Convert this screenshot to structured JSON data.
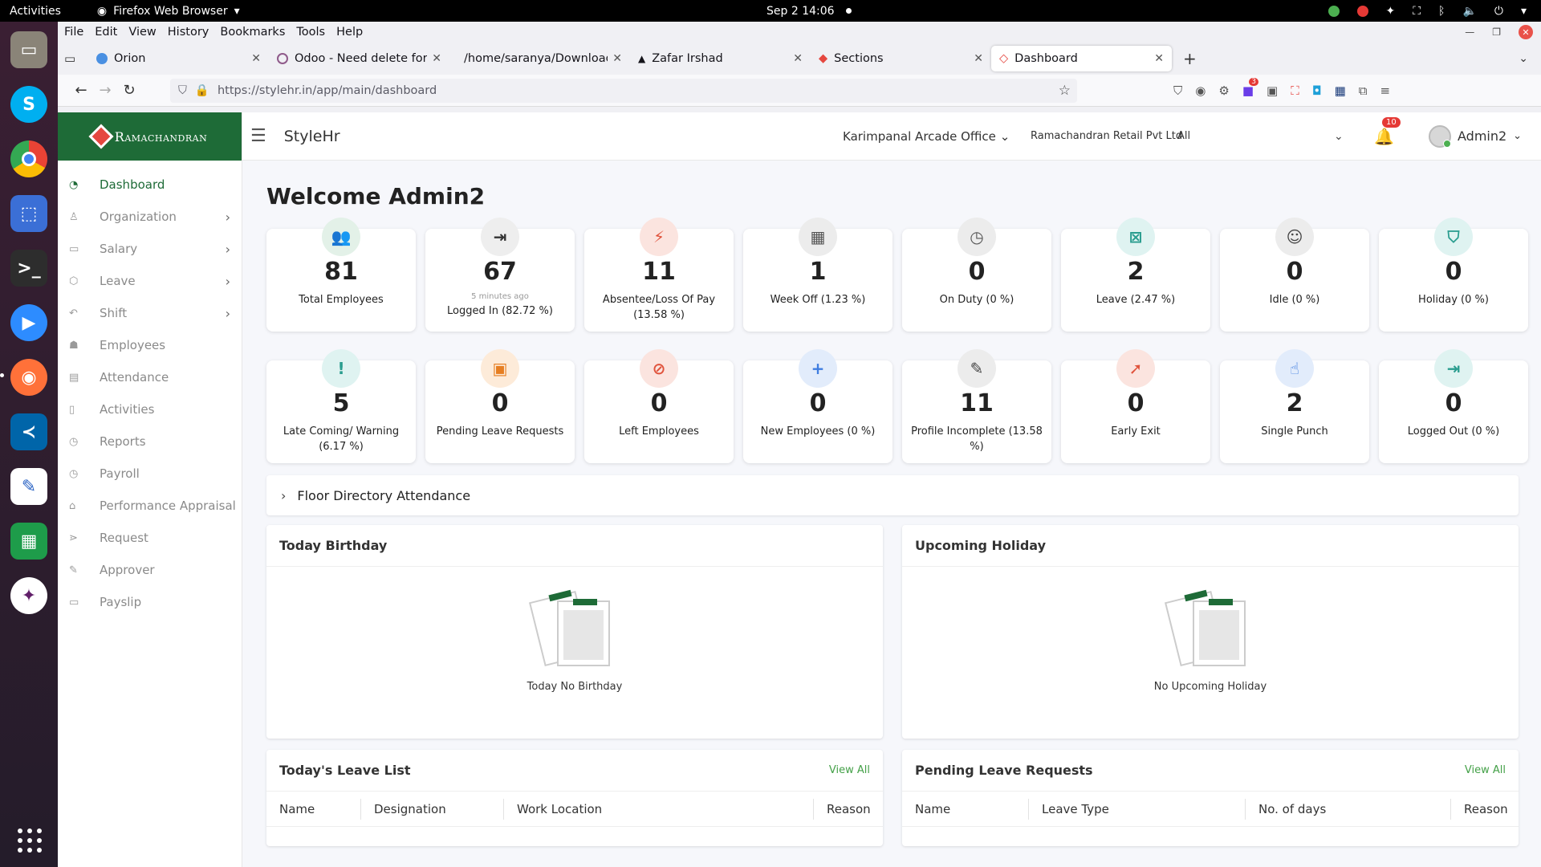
{
  "system": {
    "activities": "Activities",
    "app_name": "Firefox Web Browser",
    "clock": "Sep 2  14:06"
  },
  "browser": {
    "menu": [
      "File",
      "Edit",
      "View",
      "History",
      "Bookmarks",
      "Tools",
      "Help"
    ],
    "tabs": [
      {
        "title": "Orion",
        "active": false
      },
      {
        "title": "Odoo - Need delete for S",
        "active": false
      },
      {
        "title": "/home/saranya/Downloads/",
        "active": false
      },
      {
        "title": "Zafar Irshad",
        "active": false
      },
      {
        "title": "Sections",
        "active": false
      },
      {
        "title": "Dashboard",
        "active": true
      }
    ],
    "url": "https://stylehr.in/app/main/dashboard",
    "ext_badge": "3"
  },
  "app": {
    "logo_text": "Ramachandran",
    "title": "StyleHr",
    "office": "Karimpanal Arcade Office",
    "company": "Ramachandran Retail Pvt Ltd",
    "filter": "All",
    "notifications": "10",
    "user": "Admin2",
    "colors": {
      "brand_green": "#1e6b37",
      "accent_red": "#e53935"
    }
  },
  "sidebar": [
    {
      "label": "Dashboard",
      "icon": "dashboard-icon",
      "active": true,
      "chevron": false
    },
    {
      "label": "Organization",
      "icon": "user-icon",
      "chevron": true
    },
    {
      "label": "Salary",
      "icon": "salary-icon",
      "chevron": true
    },
    {
      "label": "Leave",
      "icon": "leave-icon",
      "chevron": true
    },
    {
      "label": "Shift",
      "icon": "shift-icon",
      "chevron": true
    },
    {
      "label": "Employees",
      "icon": "employees-icon",
      "chevron": false
    },
    {
      "label": "Attendance",
      "icon": "attendance-icon",
      "chevron": false
    },
    {
      "label": "Activities",
      "icon": "activities-icon",
      "chevron": false
    },
    {
      "label": "Reports",
      "icon": "reports-icon",
      "chevron": false
    },
    {
      "label": "Payroll",
      "icon": "payroll-icon",
      "chevron": false
    },
    {
      "label": "Performance Appraisal",
      "icon": "appraisal-icon",
      "chevron": false
    },
    {
      "label": "Request",
      "icon": "request-icon",
      "chevron": false
    },
    {
      "label": "Approver",
      "icon": "approver-icon",
      "chevron": false
    },
    {
      "label": "Payslip",
      "icon": "payslip-icon",
      "chevron": false
    }
  ],
  "welcome": "Welcome Admin2",
  "cards": [
    {
      "value": "81",
      "label": "Total Employees",
      "icon": "employees-icon",
      "color": "#2e7d4f",
      "bg": "#e3f1e8"
    },
    {
      "value": "67",
      "note": "5 minutes ago",
      "label": "Logged In  (82.72 %)",
      "icon": "login-icon",
      "color": "#333333",
      "bg": "#eeeeee"
    },
    {
      "value": "11",
      "label": "Absentee/Loss Of Pay (13.58 %)",
      "icon": "absent-icon",
      "color": "#e0533c",
      "bg": "#fbe4df"
    },
    {
      "value": "1",
      "label": "Week Off (1.23 %)",
      "icon": "calendar-icon",
      "color": "#555555",
      "bg": "#ececec"
    },
    {
      "value": "0",
      "label": "On Duty (0 %)",
      "icon": "calendar-clock-icon",
      "color": "#555555",
      "bg": "#ececec"
    },
    {
      "value": "2",
      "label": "Leave (2.47 %)",
      "icon": "calendar-x-icon",
      "color": "#2a9d8f",
      "bg": "#dff3f1"
    },
    {
      "value": "0",
      "label": "Idle (0 %)",
      "icon": "idle-icon",
      "color": "#444444",
      "bg": "#ececec"
    },
    {
      "value": "0",
      "label": "Holiday (0 %)",
      "icon": "holiday-icon",
      "color": "#2a9d8f",
      "bg": "#dff3f1"
    },
    {
      "value": "5",
      "label": "Late Coming/ Warning (6.17 %)",
      "icon": "warning-icon",
      "color": "#2a9d8f",
      "bg": "#dff3f1"
    },
    {
      "value": "0",
      "label": "Pending Leave Requests",
      "icon": "calendar-pending-icon",
      "color": "#e67e22",
      "bg": "#fdebd9"
    },
    {
      "value": "0",
      "label": "Left Employees",
      "icon": "left-icon",
      "color": "#e0533c",
      "bg": "#fbe4df"
    },
    {
      "value": "0",
      "label": "New Employees (0 %)",
      "icon": "add-user-icon",
      "color": "#3f7de0",
      "bg": "#e2ecfb"
    },
    {
      "value": "11",
      "label": "Profile Incomplete (13.58 %)",
      "icon": "edit-user-icon",
      "color": "#444444",
      "bg": "#ececec"
    },
    {
      "value": "0",
      "label": "Early Exit",
      "icon": "run-icon",
      "color": "#e0533c",
      "bg": "#fbe4df"
    },
    {
      "value": "2",
      "label": "Single Punch",
      "icon": "punch-icon",
      "color": "#3f7de0",
      "bg": "#e2ecfb"
    },
    {
      "value": "0",
      "label": "Logged Out (0 %)",
      "icon": "logout-icon",
      "color": "#2a9d8f",
      "bg": "#dff3f1"
    }
  ],
  "floor": "Floor Directory Attendance",
  "birthday": {
    "title": "Today Birthday",
    "empty": "Today No Birthday"
  },
  "holiday": {
    "title": "Upcoming Holiday",
    "empty": "No Upcoming Holiday"
  },
  "leave_list": {
    "title": "Today's Leave List",
    "view_all": "View All",
    "columns": [
      "Name",
      "Designation",
      "Work Location",
      "Reason"
    ]
  },
  "pending": {
    "title": "Pending Leave Requests",
    "view_all": "View All",
    "columns": [
      "Name",
      "Leave Type",
      "No. of days",
      "Reason"
    ]
  }
}
